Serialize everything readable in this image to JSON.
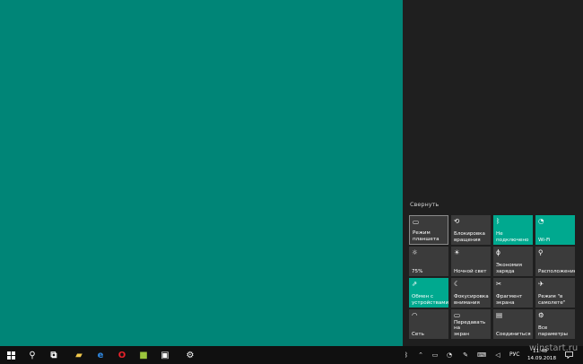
{
  "action_center": {
    "collapse_label": "Свернуть",
    "tiles": [
      {
        "label": "Режим\nпланшета",
        "icon": "tablet-mode-icon",
        "glyph": "▭",
        "active": false
      },
      {
        "label": "Блокировка\nвращения",
        "icon": "rotation-lock-icon",
        "glyph": "⟲",
        "active": false
      },
      {
        "label": "Не\nподключено",
        "icon": "bluetooth-icon",
        "glyph": "ᛒ",
        "active": true
      },
      {
        "label": "Wi-Fi",
        "icon": "wifi-icon",
        "glyph": "◔",
        "active": true
      },
      {
        "label": "75%",
        "icon": "brightness-icon",
        "glyph": "☼",
        "active": false
      },
      {
        "label": "Ночной свет",
        "icon": "night-light-icon",
        "glyph": "☀",
        "active": false
      },
      {
        "label": "Экономия\nзаряда",
        "icon": "battery-saver-icon",
        "glyph": "ϕ",
        "active": false
      },
      {
        "label": "Расположение",
        "icon": "location-icon",
        "glyph": "⚲",
        "active": false
      },
      {
        "label": "Обмен с\nустройствами",
        "icon": "nearby-sharing-icon",
        "glyph": "⇗",
        "active": true
      },
      {
        "label": "Фокусировка\nвнимания",
        "icon": "focus-assist-icon",
        "glyph": "☾",
        "active": false
      },
      {
        "label": "Фрагмент\nэкрана",
        "icon": "screen-snip-icon",
        "glyph": "✂",
        "active": false
      },
      {
        "label": "Режим \"в\nсамолете\"",
        "icon": "airplane-icon",
        "glyph": "✈",
        "active": false
      },
      {
        "label": "Сеть",
        "icon": "network-icon",
        "glyph": "◠",
        "active": false
      },
      {
        "label": "Передавать на\nэкран",
        "icon": "project-icon",
        "glyph": "▭",
        "active": false
      },
      {
        "label": "Соединиться",
        "icon": "connect-icon",
        "glyph": "▤",
        "active": false
      },
      {
        "label": "Все параметры",
        "icon": "settings-icon",
        "glyph": "⚙",
        "active": false
      }
    ]
  },
  "taskbar": {
    "language": "РУС",
    "time": "11:48",
    "date": "14.09.2018",
    "apps": [
      {
        "name": "search-icon",
        "glyph": "⚲",
        "color": "#ffffff"
      },
      {
        "name": "task-view-icon",
        "glyph": "⧉",
        "color": "#ffffff"
      },
      {
        "name": "file-explorer-icon",
        "glyph": "▰",
        "color": "#f2c94c"
      },
      {
        "name": "edge-icon",
        "glyph": "e",
        "color": "#2f8ae5"
      },
      {
        "name": "opera-icon",
        "glyph": "O",
        "color": "#e8222a"
      },
      {
        "name": "android-app-icon",
        "glyph": "■",
        "color": "#9bc53d"
      },
      {
        "name": "store-icon",
        "glyph": "▣",
        "color": "#ffffff"
      },
      {
        "name": "settings-app-icon",
        "glyph": "⚙",
        "color": "#ffffff"
      }
    ],
    "tray": [
      {
        "name": "bluetooth-tray-icon",
        "glyph": "ᛒ"
      },
      {
        "name": "hidden-icons-icon",
        "glyph": "⌃"
      },
      {
        "name": "battery-tray-icon",
        "glyph": "▭"
      },
      {
        "name": "wifi-tray-icon",
        "glyph": "◔"
      },
      {
        "name": "pen-icon",
        "glyph": "✎"
      },
      {
        "name": "keyboard-icon",
        "glyph": "⌨"
      },
      {
        "name": "volume-icon",
        "glyph": "◁"
      }
    ]
  },
  "watermark": "winstart.ru",
  "colors": {
    "accent": "#00a98f",
    "desktop": "#008577",
    "panel": "#1f1f1f",
    "tile": "#3b3b3b"
  }
}
